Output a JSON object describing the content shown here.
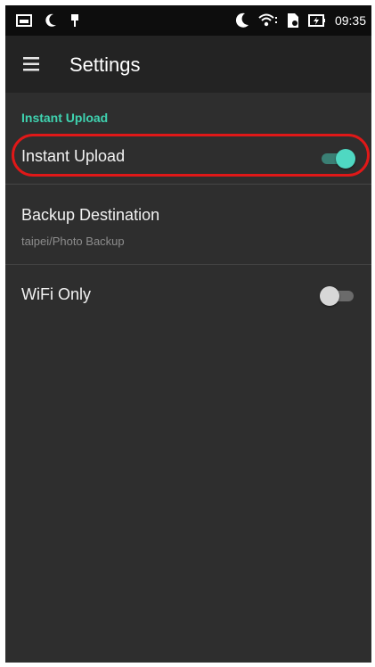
{
  "status_bar": {
    "time": "09:35",
    "left_icons": [
      "gallery-icon",
      "moon-icon",
      "pin-icon"
    ],
    "right_icons": [
      "moon-icon",
      "wifi-icon",
      "sim-icon",
      "battery-charging-icon"
    ]
  },
  "app_bar": {
    "title": "Settings",
    "menu_icon": "hamburger-menu-icon"
  },
  "section": {
    "header": "Instant Upload"
  },
  "settings": {
    "instant_upload": {
      "label": "Instant Upload",
      "enabled": true
    },
    "backup_destination": {
      "label": "Backup Destination",
      "value": "taipei/Photo Backup"
    },
    "wifi_only": {
      "label": "WiFi Only",
      "enabled": false
    }
  },
  "colors": {
    "accent": "#3fd3b0",
    "toggle_on": "#4fd8c2",
    "background": "#2e2e2e",
    "app_bar": "#232323",
    "highlight": "#e01818"
  }
}
